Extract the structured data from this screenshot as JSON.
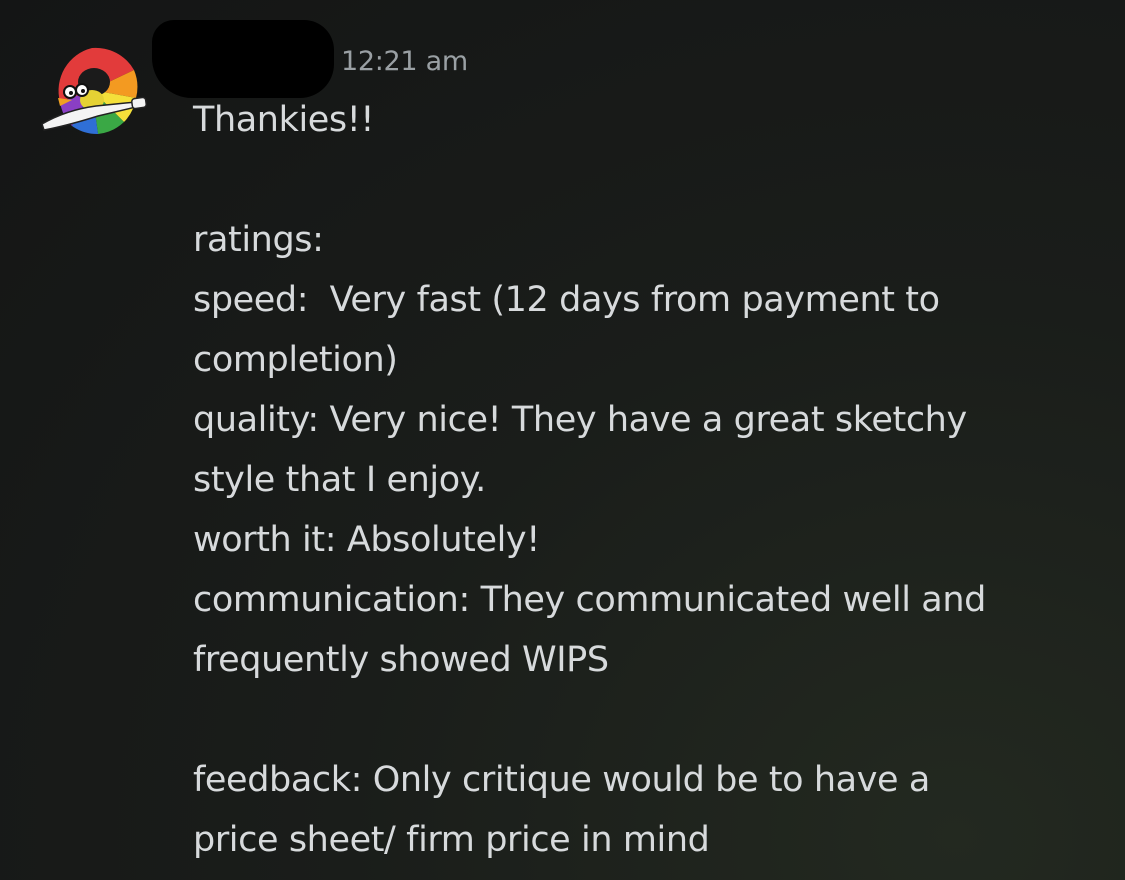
{
  "message": {
    "timestamp": "12:21 am",
    "lines": [
      "Thankies!!",
      "",
      "ratings:",
      "speed:  Very fast (12 days from payment to",
      "completion)",
      "quality: Very nice! They have a great sketchy",
      "style that I enjoy.",
      "worth it: Absolutely!",
      "communication: They communicated well and",
      "frequently showed WIPS",
      "",
      "feedback: Only critique would be to have a",
      "price sheet/ firm price in mind"
    ]
  },
  "colors": {
    "background": "#161816",
    "text": "#d7dadc",
    "timestamp": "#9aa0a4",
    "redaction": "#000000"
  },
  "avatar": {
    "icon": "pride-duck-with-knife-icon"
  }
}
